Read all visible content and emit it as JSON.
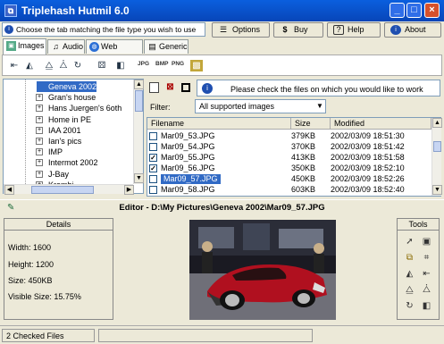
{
  "window": {
    "title": "Triplehash Hutmil 6.0",
    "app_icon": "hutmil-app-icon",
    "controls": [
      "_",
      "□",
      "×"
    ]
  },
  "hint": "Choose the tab matching the file type you wish to use",
  "top_buttons": [
    {
      "label": "Options",
      "icon": "options-icon"
    },
    {
      "label": "Buy",
      "icon": "dollar-icon"
    },
    {
      "label": "Help",
      "icon": "help-icon"
    },
    {
      "label": "About",
      "icon": "info-icon"
    }
  ],
  "tabs": [
    {
      "label": "Images",
      "icon": "images-icon",
      "active": true
    },
    {
      "label": "Audio",
      "icon": "audio-icon",
      "active": false
    },
    {
      "label": "Web Pages",
      "icon": "web-pages-icon",
      "active": false
    },
    {
      "label": "Generic",
      "icon": "generic-icon",
      "active": false
    }
  ],
  "toolbar": {
    "format_labels": [
      "JPG",
      "BMP",
      "PNG"
    ]
  },
  "tree": {
    "items": [
      {
        "label": "Geneva 2002",
        "selected": true,
        "expandable": false
      },
      {
        "label": "Gran's house",
        "selected": false,
        "expandable": true
      },
      {
        "label": "Hans Juergen's 6oth",
        "selected": false,
        "expandable": true
      },
      {
        "label": "Home in PE",
        "selected": false,
        "expandable": true
      },
      {
        "label": "IAA 2001",
        "selected": false,
        "expandable": true
      },
      {
        "label": "Ian's pics",
        "selected": false,
        "expandable": true
      },
      {
        "label": "IMP",
        "selected": false,
        "expandable": true
      },
      {
        "label": "Intermot 2002",
        "selected": false,
        "expandable": true
      },
      {
        "label": "J-Bay",
        "selected": false,
        "expandable": true
      },
      {
        "label": "Krombi",
        "selected": false,
        "expandable": true
      }
    ]
  },
  "message": "Please check the files on which you would like to work",
  "filter": {
    "label": "Filter:",
    "value": "All supported images"
  },
  "files": {
    "columns": [
      "Filename",
      "Size",
      "Modified"
    ],
    "rows": [
      {
        "name": "Mar09_53.JPG",
        "size": "379KB",
        "modified": "2002/03/09 18:51:30",
        "checked": false,
        "selected": false
      },
      {
        "name": "Mar09_54.JPG",
        "size": "370KB",
        "modified": "2002/03/09 18:51:42",
        "checked": false,
        "selected": false
      },
      {
        "name": "Mar09_55.JPG",
        "size": "413KB",
        "modified": "2002/03/09 18:51:58",
        "checked": true,
        "selected": false
      },
      {
        "name": "Mar09_56.JPG",
        "size": "350KB",
        "modified": "2002/03/09 18:52:10",
        "checked": true,
        "selected": false
      },
      {
        "name": "Mar09_57.JPG",
        "size": "450KB",
        "modified": "2002/03/09 18:52:26",
        "checked": false,
        "selected": true
      },
      {
        "name": "Mar09_58.JPG",
        "size": "603KB",
        "modified": "2002/03/09 18:52:40",
        "checked": false,
        "selected": false
      }
    ]
  },
  "editor": {
    "title": "Editor - D:\\My Pictures\\Geneva 2002\\Mar09_57.JPG"
  },
  "details": {
    "header": "Details",
    "width": "Width: 1600",
    "height": "Height: 1200",
    "size": "Size: 450KB",
    "visible_size": "Visible Size: 15.75%"
  },
  "tools": {
    "header": "Tools"
  },
  "status": {
    "text": "2 Checked Files"
  },
  "colors": {
    "titlebar": "#0845b8",
    "selection": "#316ac5",
    "window_bg": "#ece9d8",
    "car_body": "#b0101f"
  }
}
